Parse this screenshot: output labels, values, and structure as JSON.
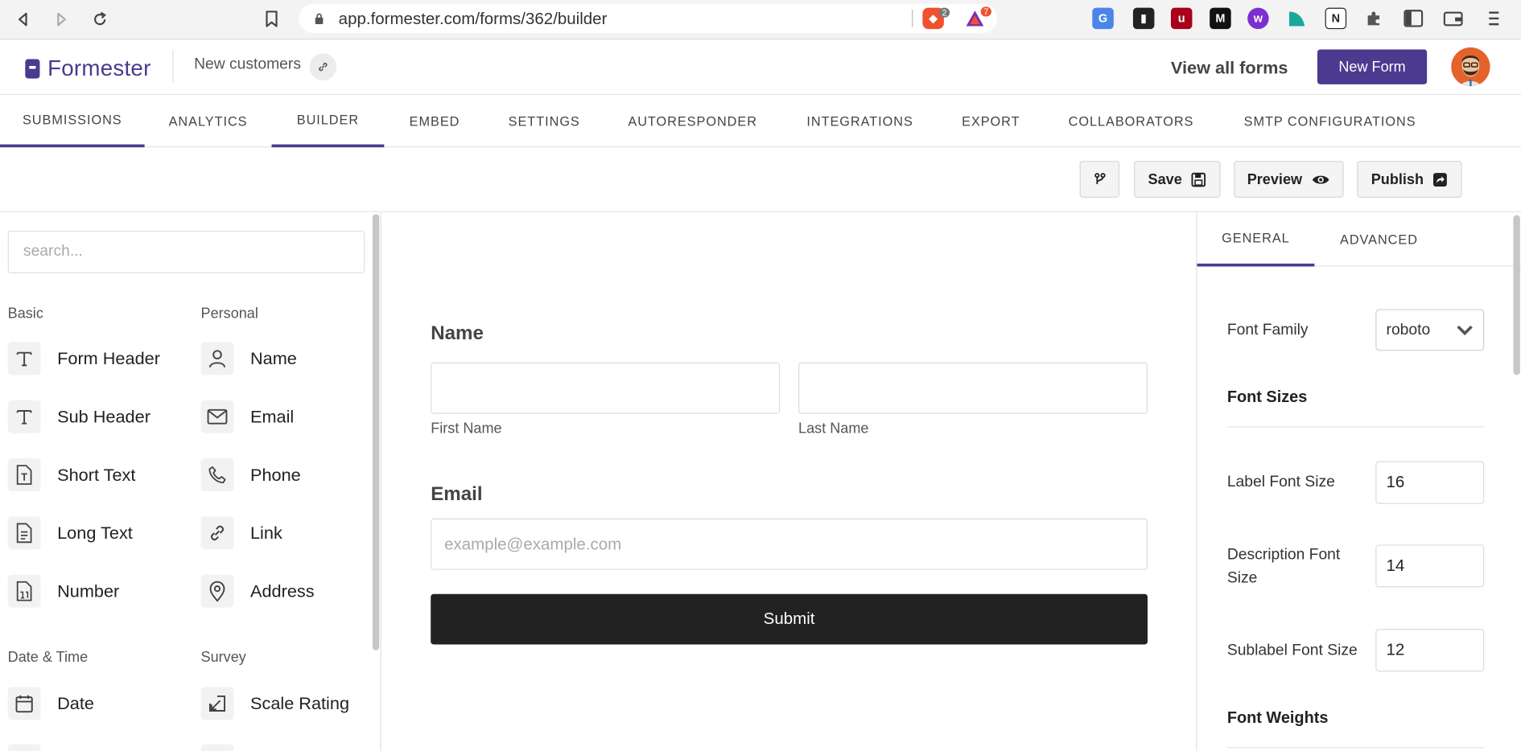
{
  "browser": {
    "url": "app.formester.com/forms/362/builder",
    "brave_badge": "2",
    "bat_badge": "7"
  },
  "header": {
    "logo_text": "Formester",
    "form_name": "New customers",
    "view_all_label": "View all forms",
    "new_form_label": "New Form"
  },
  "tabs": [
    {
      "label": "SUBMISSIONS"
    },
    {
      "label": "ANALYTICS"
    },
    {
      "label": "BUILDER"
    },
    {
      "label": "EMBED"
    },
    {
      "label": "SETTINGS"
    },
    {
      "label": "AUTORESPONDER"
    },
    {
      "label": "INTEGRATIONS"
    },
    {
      "label": "EXPORT"
    },
    {
      "label": "COLLABORATORS"
    },
    {
      "label": "SMTP CONFIGURATIONS"
    }
  ],
  "toolbar": {
    "save_label": "Save",
    "preview_label": "Preview",
    "publish_label": "Publish"
  },
  "sidebar": {
    "search_placeholder": "search...",
    "categories": {
      "basic": "Basic",
      "personal": "Personal",
      "datetime": "Date & Time",
      "survey": "Survey"
    },
    "basic_fields": [
      "Form Header",
      "Sub Header",
      "Short Text",
      "Long Text",
      "Number"
    ],
    "personal_fields": [
      "Name",
      "Email",
      "Phone",
      "Link",
      "Address"
    ],
    "datetime_fields": [
      "Date"
    ],
    "survey_fields": [
      "Scale Rating"
    ]
  },
  "form": {
    "name_label": "Name",
    "first_name_sublabel": "First Name",
    "last_name_sublabel": "Last Name",
    "email_label": "Email",
    "email_placeholder": "example@example.com",
    "submit_label": "Submit"
  },
  "properties": {
    "tab_general": "GENERAL",
    "tab_advanced": "ADVANCED",
    "font_family_label": "Font Family",
    "font_family_value": "roboto",
    "font_sizes_heading": "Font Sizes",
    "label_font_size_label": "Label Font Size",
    "label_font_size_value": "16",
    "description_font_size_label": "Description Font Size",
    "description_font_size_value": "14",
    "sublabel_font_size_label": "Sublabel Font Size",
    "sublabel_font_size_value": "12",
    "font_weights_heading": "Font Weights"
  },
  "colors": {
    "brand": "#4b3a8f",
    "submit_bg": "#222222"
  }
}
